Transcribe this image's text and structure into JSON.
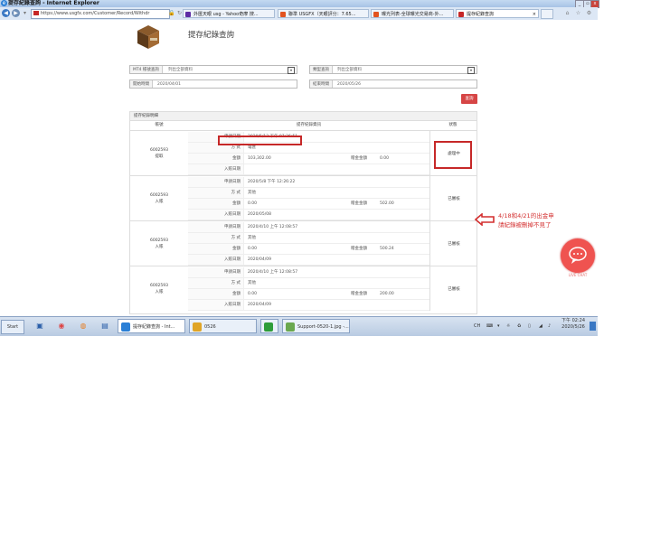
{
  "window": {
    "title": "提存紀錄查詢 - Internet Explorer",
    "min_label": "_",
    "max_label": "▫",
    "close_label": "x"
  },
  "browser": {
    "url": "https://www.usgfx.com/Customer/Record/Withdr",
    "tabs": [
      {
        "label": "外匯天眼 usg - Yahoo奇摩 搜...",
        "color": "#5e2ca5"
      },
      {
        "label": "聯準 USGFX（天眼評分：7.65...",
        "color": "#e2531f"
      },
      {
        "label": "曝光列表-全球曝光交易商-外...",
        "color": "#e2531f"
      },
      {
        "label": "提存紀錄查詢",
        "color": "#c62828"
      }
    ]
  },
  "page": {
    "title": "提存紀錄查詢",
    "filters": {
      "mt4_label": "MT4 帳號查詢",
      "mt4_value": "列出全部資料",
      "type_label": "類型查詢",
      "type_value": "列出全部資料",
      "start_label": "開始時間",
      "start_value": "2020/04/01",
      "end_label": "結束時間",
      "end_value": "2020/05/26"
    },
    "query_button": "查詢",
    "table": {
      "title": "提存紀錄明細",
      "headers": [
        "帳號",
        "提存紀錄資訊",
        "狀態"
      ],
      "records": [
        {
          "account": "6002593",
          "type": "提取",
          "apply_date": "2020/5/12 下午 07:26:51",
          "method": "電匯",
          "amount": "103,302.00",
          "fee": "0.00",
          "posted_date": "",
          "status": "處理中"
        },
        {
          "account": "6002593",
          "type": "入賬",
          "apply_date": "2020/5/8 下午 12:26:22",
          "method": "其他",
          "amount": "0.00",
          "fee": "502.00",
          "posted_date": "2020/05/08",
          "status": "已審核"
        },
        {
          "account": "6002593",
          "type": "入賬",
          "apply_date": "2020/4/10 上午 12:08:57",
          "method": "其他",
          "amount": "0.00",
          "fee": "500.24",
          "posted_date": "2020/04/09",
          "status": "已審核"
        },
        {
          "account": "6002593",
          "type": "入賬",
          "apply_date": "2020/4/10 上午 12:08:57",
          "method": "其他",
          "amount": "0.00",
          "fee": "200.00",
          "posted_date": "2020/04/09",
          "status": "已審核"
        }
      ],
      "labels": {
        "apply": "申請日期",
        "method": "方 式",
        "amount": "金額",
        "fee": "贈金金額",
        "posted": "入賬日期"
      }
    },
    "annotation": {
      "line1": "4/18和4/21的出金申",
      "line2": "請紀錄被刪掉不見了"
    },
    "live_chat": "LIVE CHAT"
  },
  "taskbar": {
    "start": "Start",
    "tasks": [
      {
        "label": "提存紀錄查詢 - Int...",
        "color": "#2a7fd6"
      },
      {
        "label": "0526",
        "color": "#e0a526"
      },
      {
        "label": "",
        "color": "#2e9d3a"
      },
      {
        "label": "Support-0520-1.jpg -...",
        "color": "#6aa84f"
      }
    ],
    "lang": "CH",
    "clock_time": "下午 02:24",
    "clock_date": "2020/5/26"
  },
  "colors": {
    "accent_red": "#d64545",
    "annotation": "#d32f2f"
  }
}
